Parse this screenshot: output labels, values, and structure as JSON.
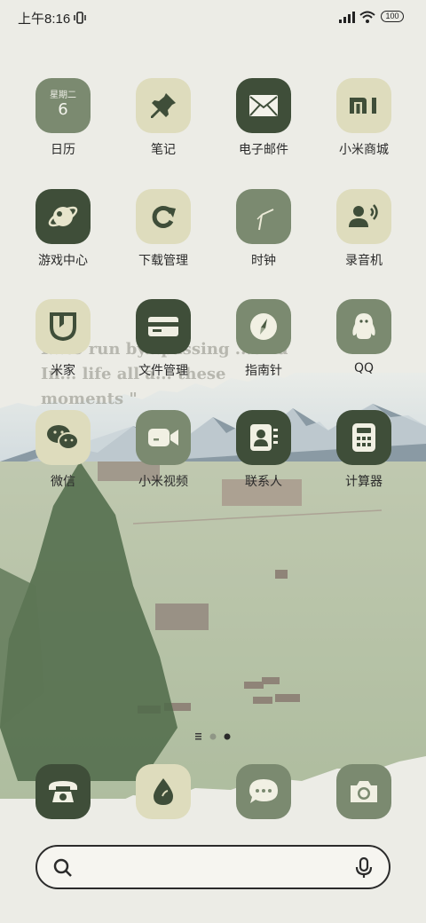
{
  "status": {
    "time": "上午8:16",
    "battery": "100"
  },
  "wallpaper": {
    "quote_lines": [
      "I...to run by...passing ...orld",
      "In... life all a... these",
      "moments \""
    ]
  },
  "apps": [
    {
      "label": "日历"
    },
    {
      "label": "笔记"
    },
    {
      "label": "电子邮件"
    },
    {
      "label": "小米商城"
    },
    {
      "label": "游戏中心"
    },
    {
      "label": "下载管理"
    },
    {
      "label": "时钟"
    },
    {
      "label": "录音机"
    },
    {
      "label": "米家"
    },
    {
      "label": "文件管理"
    },
    {
      "label": "指南针"
    },
    {
      "label": "QQ"
    },
    {
      "label": "微信"
    },
    {
      "label": "小米视频"
    },
    {
      "label": "联系人"
    },
    {
      "label": "计算器"
    }
  ],
  "calendar": {
    "weekday": "星期二",
    "day": "6"
  },
  "pager": {
    "pages": 3,
    "current_page": 3
  },
  "dock": [
    "phone-icon",
    "drop-icon",
    "message-icon",
    "camera-icon"
  ],
  "search": {
    "placeholder": ""
  },
  "colors": {
    "dark": "#4c5c44",
    "mid": "#7b8a70",
    "cream": "#dedcbd"
  }
}
